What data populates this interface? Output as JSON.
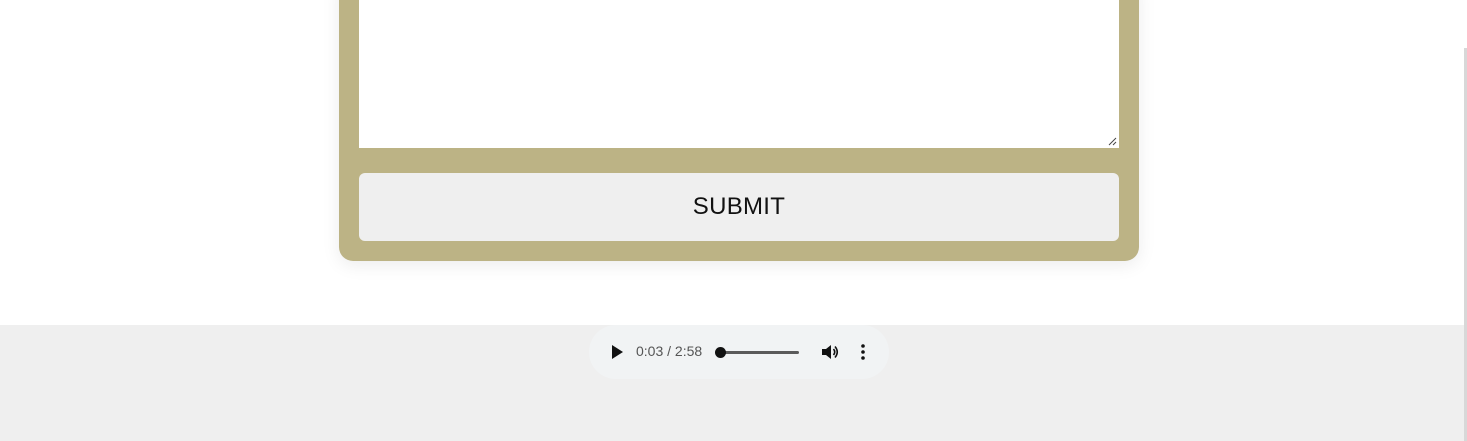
{
  "form": {
    "textarea_value": "",
    "submit_label": "SUBMIT"
  },
  "audio": {
    "current_time": "0:03",
    "duration": "2:58",
    "time_display": "0:03 / 2:58",
    "progress_fraction": 0.017,
    "play_icon": "play-icon",
    "volume_icon": "volume-icon",
    "more_icon": "more-vertical-icon"
  },
  "colors": {
    "form_card": "#bcb385",
    "submit_bg": "#efefef",
    "footer_bg": "#efefef",
    "player_bg": "#f1f3f4"
  }
}
